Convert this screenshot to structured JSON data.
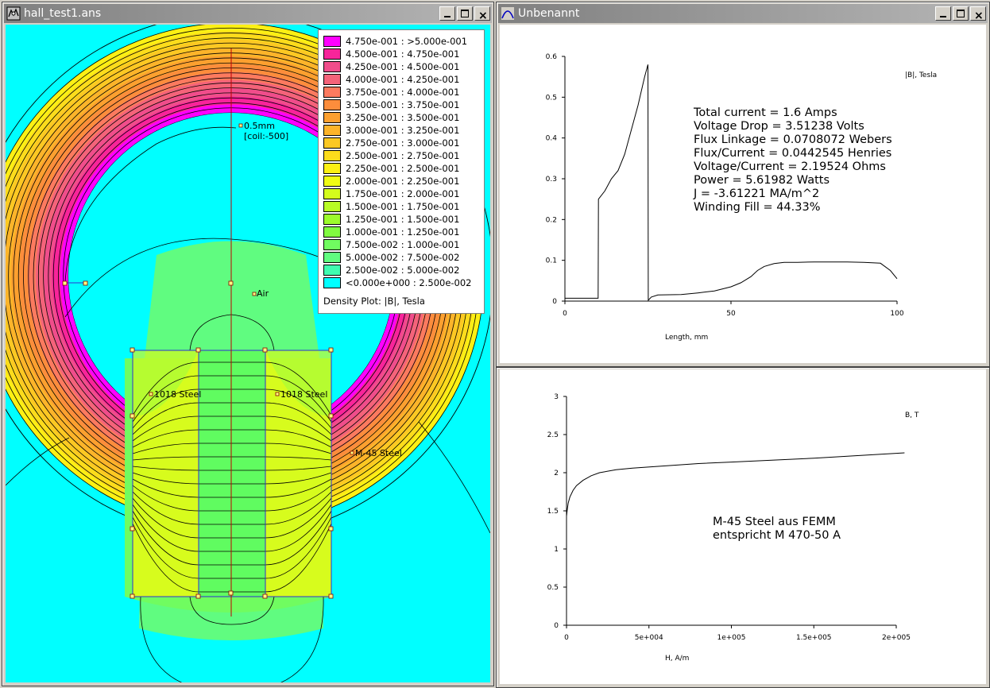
{
  "windows": {
    "model": {
      "title": "hall_test1.ans",
      "legend": {
        "title": "Density Plot: |B|, Tesla",
        "items": [
          {
            "label": "4.750e-001 : >5.000e-001",
            "color": "#ff00ff"
          },
          {
            "label": "4.500e-001 : 4.750e-001",
            "color": "#f8249a"
          },
          {
            "label": "4.250e-001 : 4.500e-001",
            "color": "#f04d8b"
          },
          {
            "label": "4.000e-001 : 4.250e-001",
            "color": "#f4637a"
          },
          {
            "label": "3.750e-001 : 4.000e-001",
            "color": "#fc7a5f"
          },
          {
            "label": "3.500e-001 : 3.750e-001",
            "color": "#fc8d3c"
          },
          {
            "label": "3.250e-001 : 3.500e-001",
            "color": "#fca02f"
          },
          {
            "label": "3.000e-001 : 3.250e-001",
            "color": "#fcb42a"
          },
          {
            "label": "2.750e-001 : 3.000e-001",
            "color": "#fcc823"
          },
          {
            "label": "2.500e-001 : 2.750e-001",
            "color": "#fcdc1c"
          },
          {
            "label": "2.250e-001 : 2.500e-001",
            "color": "#fcf014"
          },
          {
            "label": "2.000e-001 : 2.250e-001",
            "color": "#f0fc14"
          },
          {
            "label": "1.750e-001 : 2.000e-001",
            "color": "#d4fc1c"
          },
          {
            "label": "1.500e-001 : 1.750e-001",
            "color": "#b8fc24"
          },
          {
            "label": "1.250e-001 : 1.500e-001",
            "color": "#9cfc2c"
          },
          {
            "label": "1.000e-001 : 1.250e-001",
            "color": "#80fc40"
          },
          {
            "label": "7.500e-002 : 1.000e-001",
            "color": "#70fc60"
          },
          {
            "label": "5.000e-002 : 7.500e-002",
            "color": "#60fc80"
          },
          {
            "label": "2.500e-002 : 5.000e-002",
            "color": "#40fcb0"
          },
          {
            "label": "<0.000e+000 : 2.500e-002",
            "color": "#00ffff"
          }
        ]
      },
      "labels": {
        "wire": "0.5mm",
        "wire_coil": "[coil:-500]",
        "air": "Air",
        "steel_left": "1018 Steel",
        "steel_right": "1018 Steel",
        "m45": "M-45 Steel"
      }
    },
    "plot1": {
      "title": "Unbenannt",
      "chart_data": {
        "type": "line",
        "xlabel": "Length, mm",
        "ylabel": "|B|, Tesla",
        "xlim": [
          0,
          100
        ],
        "ylim": [
          0,
          0.6
        ],
        "x_ticks": [
          "0",
          "50",
          "100"
        ],
        "y_ticks": [
          "0",
          "0.1",
          "0.2",
          "0.3",
          "0.4",
          "0.5",
          "0.6"
        ],
        "x": [
          0,
          5,
          10,
          10.1,
          12,
          14,
          16,
          18,
          20,
          22,
          24,
          25,
          25.1,
          26,
          28,
          35,
          40,
          45,
          50,
          53,
          56,
          58,
          60,
          63,
          66,
          70,
          75,
          80,
          85,
          90,
          95,
          98,
          100
        ],
        "y": [
          0.007,
          0.007,
          0.007,
          0.25,
          0.27,
          0.3,
          0.32,
          0.36,
          0.42,
          0.48,
          0.55,
          0.58,
          0.002,
          0.01,
          0.015,
          0.016,
          0.02,
          0.025,
          0.035,
          0.045,
          0.06,
          0.075,
          0.085,
          0.092,
          0.095,
          0.095,
          0.096,
          0.096,
          0.096,
          0.095,
          0.093,
          0.075,
          0.055
        ],
        "annotation": [
          "Total current = 1.6 Amps",
          "Voltage Drop = 3.51238 Volts",
          "Flux Linkage = 0.0708072 Webers",
          "Flux/Current = 0.0442545 Henries",
          "Voltage/Current = 2.19524 Ohms",
          "Power = 5.61982 Watts",
          "J   = -3.61221 MA/m^2",
          "Winding Fill = 44.33%"
        ]
      }
    },
    "plot2": {
      "chart_data": {
        "type": "line",
        "xlabel": "H, A/m",
        "ylabel": "B, T",
        "xlim": [
          0,
          200000
        ],
        "ylim": [
          0,
          3
        ],
        "x_ticks": [
          "0",
          "5e+004",
          "1e+005",
          "1.5e+005",
          "2e+005"
        ],
        "y_ticks": [
          "0",
          "0.5",
          "1",
          "1.5",
          "2",
          "2.5",
          "3"
        ],
        "x": [
          0,
          500,
          1000,
          2000,
          4000,
          6000,
          10000,
          15000,
          20000,
          30000,
          40000,
          60000,
          80000,
          100000,
          150000,
          205000
        ],
        "y": [
          1.43,
          1.52,
          1.6,
          1.68,
          1.77,
          1.83,
          1.9,
          1.96,
          2.0,
          2.04,
          2.06,
          2.09,
          2.12,
          2.14,
          2.19,
          2.26
        ],
        "annotation": [
          "M-45 Steel aus FEMM",
          "entspricht M 470-50 A"
        ]
      }
    }
  }
}
